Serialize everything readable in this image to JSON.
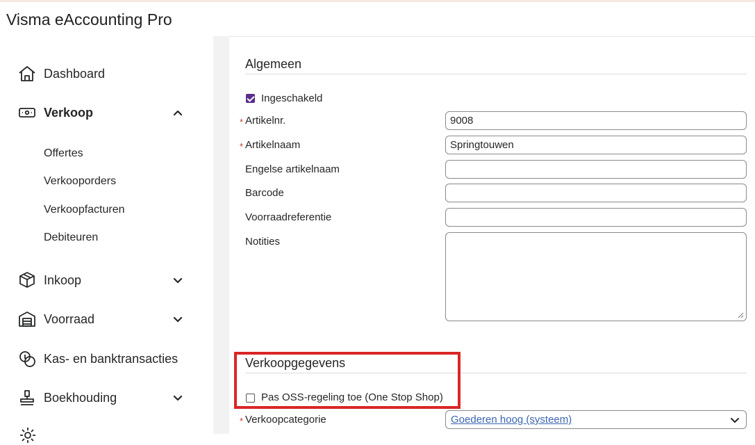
{
  "app": {
    "title": "Visma eAccounting Pro"
  },
  "sidebar": {
    "items": [
      {
        "label": "Dashboard",
        "icon": "home-icon",
        "expanded": false
      },
      {
        "label": "Verkoop",
        "icon": "sales-icon",
        "expanded": true,
        "children": [
          "Offertes",
          "Verkooporders",
          "Verkoopfacturen",
          "Debiteuren"
        ]
      },
      {
        "label": "Inkoop",
        "icon": "box-icon",
        "expanded": false
      },
      {
        "label": "Voorraad",
        "icon": "warehouse-icon",
        "expanded": false
      },
      {
        "label": "Kas- en banktransacties",
        "icon": "coins-icon",
        "expanded": false
      },
      {
        "label": "Boekhouding",
        "icon": "stamp-icon",
        "expanded": false
      }
    ]
  },
  "form": {
    "general": {
      "title": "Algemeen",
      "enabled_label": "Ingeschakeld",
      "enabled_checked": true,
      "fields": [
        {
          "label": "Artikelnr.",
          "required": true,
          "value": "9008"
        },
        {
          "label": "Artikelnaam",
          "required": true,
          "value": "Springtouwen"
        },
        {
          "label": "Engelse artikelnaam",
          "required": false,
          "value": ""
        },
        {
          "label": "Barcode",
          "required": false,
          "value": ""
        },
        {
          "label": "Voorraadreferentie",
          "required": false,
          "value": ""
        },
        {
          "label": "Notities",
          "required": false,
          "value": ""
        }
      ],
      "required_marker": "*"
    },
    "sales": {
      "title": "Verkoopgegevens",
      "oss_label": "Pas OSS-regeling toe (One Stop Shop)",
      "oss_checked": false,
      "category_label": "Verkoopcategorie",
      "category_value": "Goederen hoog (systeem)"
    }
  },
  "colors": {
    "accent_checkbox": "#5a2d8c",
    "highlight_border": "#d92626",
    "link": "#3a66b0",
    "required": "#c0392b"
  }
}
